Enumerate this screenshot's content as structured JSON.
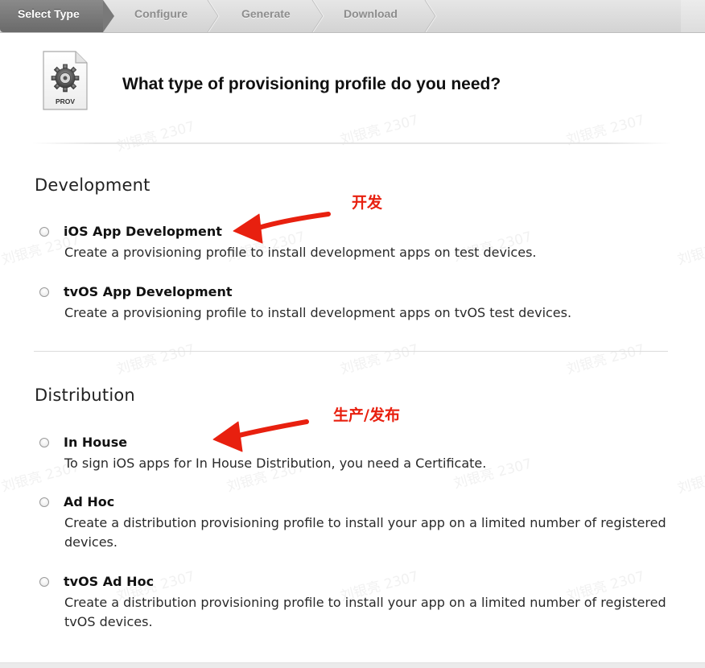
{
  "steps": [
    {
      "label": "Select Type",
      "active": true
    },
    {
      "label": "Configure",
      "active": false
    },
    {
      "label": "Generate",
      "active": false
    },
    {
      "label": "Download",
      "active": false
    }
  ],
  "header": {
    "icon_label": "PROV",
    "title": "What type of provisioning profile do you need?"
  },
  "development": {
    "title": "Development",
    "options": [
      {
        "name": "iOS App Development",
        "description": "Create a provisioning profile to install development apps on test devices.",
        "selected": false
      },
      {
        "name": "tvOS App Development",
        "description": "Create a provisioning profile to install development apps on tvOS test devices.",
        "selected": false
      }
    ]
  },
  "distribution": {
    "title": "Distribution",
    "options": [
      {
        "name": "In House",
        "description": "To sign iOS apps for In House Distribution, you need a Certificate.",
        "selected": false
      },
      {
        "name": "Ad Hoc",
        "description": "Create a distribution provisioning profile to install your app on a limited number of registered devices.",
        "selected": false
      },
      {
        "name": "tvOS Ad Hoc",
        "description": "Create a distribution provisioning profile to install your app on a limited number of registered tvOS devices.",
        "selected": false
      }
    ]
  },
  "annotations": {
    "development_note": "开发",
    "distribution_note": "生产/发布",
    "color": "#e8200f"
  },
  "watermark": "刘银亮 2307",
  "colors": {
    "active_step_bg": "#7a7a7a",
    "inactive_step_text": "#8d8d8d"
  }
}
